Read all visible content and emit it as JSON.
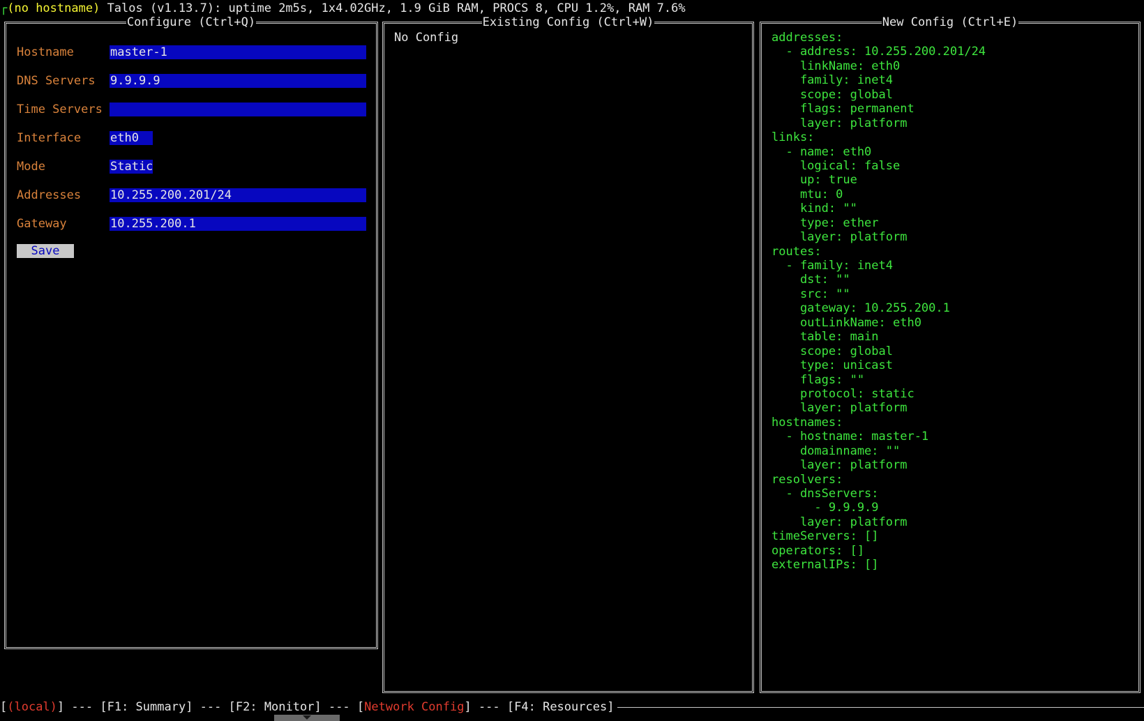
{
  "header": {
    "corner": "┌",
    "hostname": "(no hostname)",
    "status": "Talos (v1.13.7): uptime 2m5s, 1x4.02GHz, 1.9 GiB RAM, PROCS 8, CPU 1.2%, RAM 7.6%"
  },
  "configure": {
    "title": "Configure (Ctrl+Q)",
    "fields": [
      {
        "label": "Hostname",
        "value": "master-1"
      },
      {
        "label": "DNS Servers",
        "value": "9.9.9.9"
      },
      {
        "label": "Time Servers",
        "value": ""
      },
      {
        "label": "Interface",
        "value": "eth0"
      },
      {
        "label": "Mode",
        "value": "Static"
      },
      {
        "label": "Addresses",
        "value": "10.255.200.201/24"
      },
      {
        "label": "Gateway",
        "value": "10.255.200.1"
      }
    ],
    "save_label": "Save"
  },
  "existing": {
    "title": "Existing Config (Ctrl+W)",
    "content": "No Config"
  },
  "new_config": {
    "title": "New Config (Ctrl+E)",
    "lines": [
      "addresses:",
      "  - address: 10.255.200.201/24",
      "    linkName: eth0",
      "    family: inet4",
      "    scope: global",
      "    flags: permanent",
      "    layer: platform",
      "links:",
      "  - name: eth0",
      "    logical: false",
      "    up: true",
      "    mtu: 0",
      "    kind: \"\"",
      "    type: ether",
      "    layer: platform",
      "routes:",
      "  - family: inet4",
      "    dst: \"\"",
      "    src: \"\"",
      "    gateway: 10.255.200.1",
      "    outLinkName: eth0",
      "    table: main",
      "    scope: global",
      "    type: unicast",
      "    flags: \"\"",
      "    protocol: static",
      "    layer: platform",
      "hostnames:",
      "  - hostname: master-1",
      "    domainname: \"\"",
      "    layer: platform",
      "resolvers:",
      "  - dnsServers:",
      "      - 9.9.9.9",
      "    layer: platform",
      "timeServers: []",
      "operators: []",
      "externalIPs: []"
    ]
  },
  "footer": {
    "local": "(local)",
    "sep": " --- ",
    "f1": "F1: Summary",
    "f2": "F2: Monitor",
    "network": "Network Config",
    "f4": "F4: Resources"
  },
  "colors": {
    "field_bg": "#0707bf",
    "label": "#d9823b",
    "yaml": "#3ee63e",
    "active_tab": "#e13b2e",
    "hostname": "#f7f733"
  }
}
